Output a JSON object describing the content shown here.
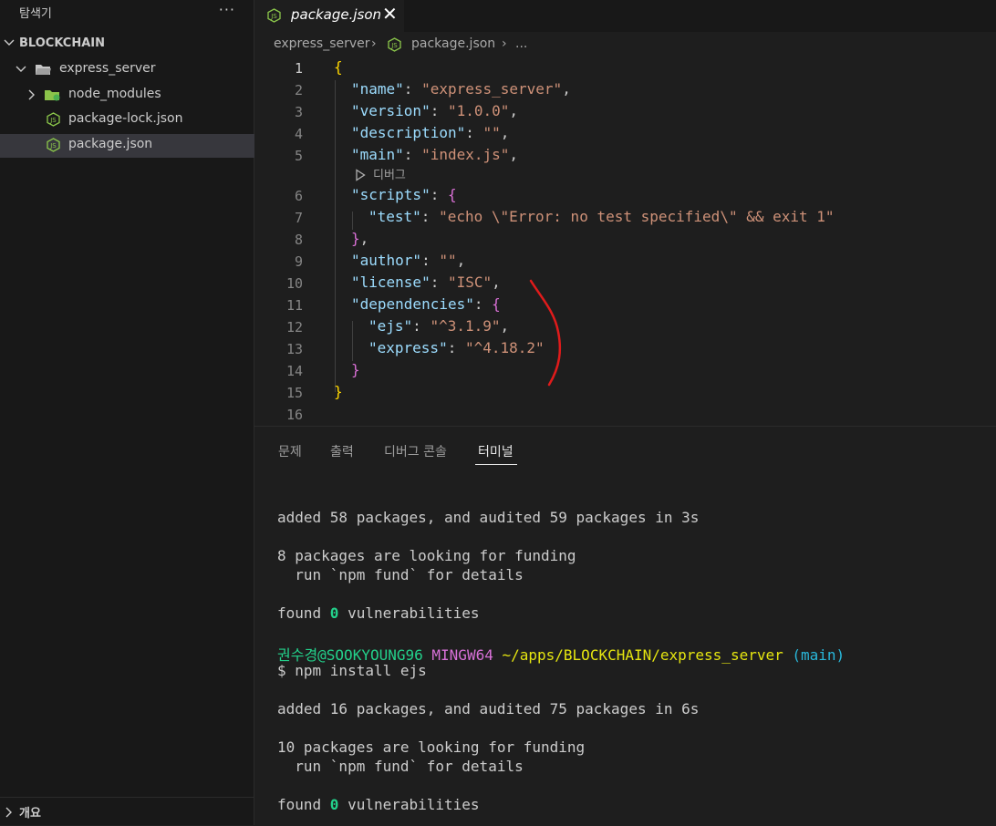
{
  "sidebar": {
    "title": "탐색기",
    "more_label": "···",
    "section": "BLOCKCHAIN",
    "folder": "express_server",
    "items": [
      {
        "label": "node_modules"
      },
      {
        "label": "package-lock.json"
      },
      {
        "label": "package.json"
      }
    ],
    "outline_label": "개요"
  },
  "tab": {
    "label": "package.json",
    "close": "✕"
  },
  "breadcrumb": {
    "folder": "express_server",
    "sep1": "›",
    "file": "package.json",
    "sep2": "›",
    "more": "..."
  },
  "editor": {
    "line_numbers": [
      "1",
      "2",
      "3",
      "4",
      "5",
      "6",
      "7",
      "8",
      "9",
      "10",
      "11",
      "12",
      "13",
      "14",
      "15",
      "16"
    ],
    "lines": {
      "l1_brace": "{",
      "l2_key": "\"name\"",
      "l2_val": "\"express_server\"",
      "l3_key": "\"version\"",
      "l3_val": "\"1.0.0\"",
      "l4_key": "\"description\"",
      "l4_val": "\"\"",
      "l5_key": "\"main\"",
      "l5_val": "\"index.js\"",
      "l6_key": "\"scripts\"",
      "l6_brace": "{",
      "l7_key": "\"test\"",
      "l7_val": "\"echo \\\"Error: no test specified\\\" && exit 1\"",
      "l8_brace": "}",
      "l9_key": "\"author\"",
      "l9_val": "\"\"",
      "l10_key": "\"license\"",
      "l10_val": "\"ISC\"",
      "l11_key": "\"dependencies\"",
      "l11_brace": "{",
      "l12_key": "\"ejs\"",
      "l12_val": "\"^3.1.9\"",
      "l13_key": "\"express\"",
      "l13_val": "\"^4.18.2\"",
      "l14_brace": "}",
      "l15_brace": "}"
    },
    "codelens": "디버그",
    "annotation_color": "#e01b1b"
  },
  "panel": {
    "tabs": [
      "문제",
      "출력",
      "디버그 콘솔",
      "터미널"
    ],
    "active_tab": "터미널",
    "terminal": {
      "l1": "added 58 packages, and audited 59 packages in 3s",
      "l2": "8 packages are looking for funding",
      "l3": "  run `npm fund` for details",
      "l4_pre": "found ",
      "l4_num": "0",
      "l4_post": " vulnerabilities",
      "prompt_user": "권수경@SOOKYOUNG96",
      "prompt_env": "MINGW64",
      "prompt_path": "~/apps/BLOCKCHAIN/express_server",
      "prompt_branch": "(main)",
      "command": "$ npm install ejs",
      "l5": "added 16 packages, and audited 75 packages in 6s",
      "l6": "10 packages are looking for funding",
      "l7": "  run `npm fund` for details",
      "l8_pre": "found ",
      "l8_num": "0",
      "l8_post": " vulnerabilities"
    }
  }
}
